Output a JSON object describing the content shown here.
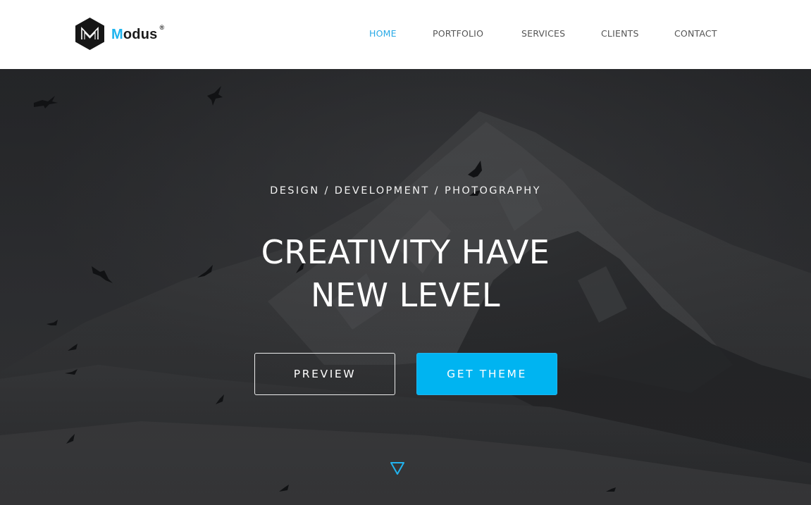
{
  "header": {
    "logo": {
      "text_first": "M",
      "text_rest": "odus",
      "registered_mark": "®",
      "mark_icon": "hexagon-m-logo-icon",
      "brand_color": "#1eb4ee"
    },
    "nav": [
      {
        "label": "HOME",
        "active": true
      },
      {
        "label": "PORTFOLIO",
        "active": false
      },
      {
        "label": "SERVICES",
        "active": false
      },
      {
        "label": "CLIENTS",
        "active": false
      },
      {
        "label": "CONTACT",
        "active": false
      }
    ],
    "active_color": "#28a9e6"
  },
  "hero": {
    "background": "dark snowy mountain with flying birds",
    "tagline": "DESIGN / DEVELOPMENT / PHOTOGRAPHY",
    "headline_line1": "CREATIVITY HAVE",
    "headline_line2": "NEW LEVEL",
    "buttons": {
      "preview_label": "PREVIEW",
      "get_theme_label": "GET THEME"
    },
    "scroll_icon": "triangle-down-icon",
    "accent_color": "#00b4f1"
  }
}
